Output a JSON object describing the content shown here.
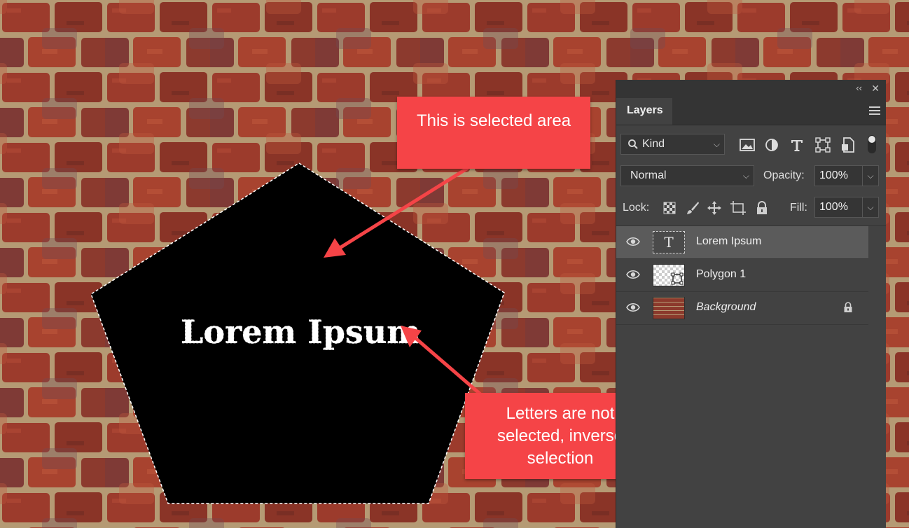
{
  "canvas": {
    "shape_text": "Lorem Ipsum",
    "callout_selected": "This is selected area",
    "callout_letters": "Letters are not selected, inverse selection"
  },
  "panel": {
    "tab_label": "Layers",
    "filter_kind": "Kind",
    "blend_mode": "Normal",
    "opacity_label": "Opacity:",
    "opacity_value": "100%",
    "lock_label": "Lock:",
    "fill_label": "Fill:",
    "fill_value": "100%",
    "layers": [
      {
        "name": "Lorem Ipsum",
        "selected": true
      },
      {
        "name": "Polygon 1",
        "selected": false
      },
      {
        "name": "Background",
        "selected": false,
        "locked": true
      }
    ]
  },
  "colors": {
    "callout": "#f54447",
    "panel_bg": "#424242",
    "selected_row": "#5b5b5b"
  }
}
